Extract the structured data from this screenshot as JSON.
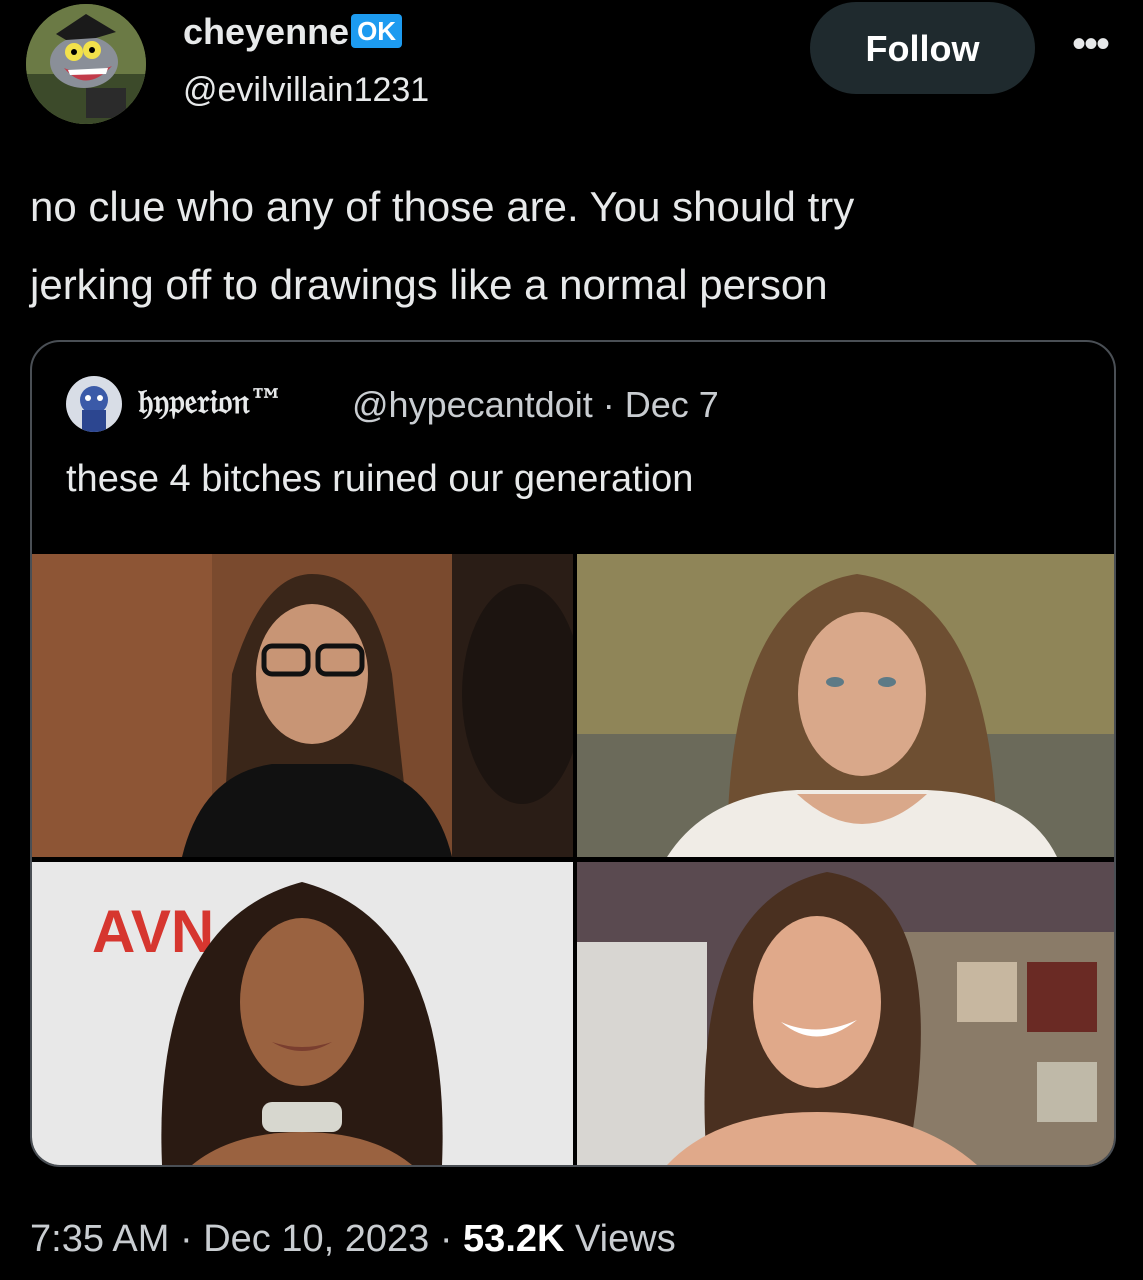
{
  "author": {
    "display_name": "cheyenne",
    "badge": "OK",
    "handle": "@evilvillain1231"
  },
  "actions": {
    "follow_label": "Follow",
    "more_label": "•••"
  },
  "tweet": {
    "lines": [
      "no clue who any of those are. You should try",
      "jerking off to drawings like a normal person"
    ]
  },
  "quoted": {
    "display_name": "𝔥𝔶𝔭𝔢𝔯𝔦𝔬𝔫™",
    "handle": "@hypecantdoit",
    "separator": "·",
    "date": "Dec 7",
    "text": "these 4 bitches ruined our generation",
    "photos": [
      {
        "name": "photo-1",
        "sign": ""
      },
      {
        "name": "photo-2",
        "sign": ""
      },
      {
        "name": "photo-3",
        "sign": "AVN"
      },
      {
        "name": "photo-4",
        "sign": ""
      }
    ]
  },
  "footer": {
    "time": "7:35 AM",
    "sep1": "·",
    "date": "Dec 10, 2023",
    "sep2": "·",
    "views_count": "53.2K",
    "views_label": "Views"
  },
  "colors": {
    "background": "#000000",
    "text": "#e7e9ea",
    "muted": "#c9cdd1",
    "badge": "#1d9bf0",
    "follow_button": "#1f2a2e",
    "card_border": "#4a4f55"
  }
}
